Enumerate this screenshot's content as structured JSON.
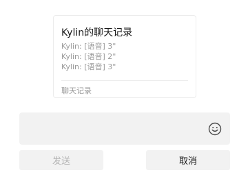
{
  "card": {
    "title": "Kylin的聊天记录",
    "messages": [
      "Kylin: [语音] 3\"",
      "Kylin: [语音] 2\"",
      "Kylin: [语音] 3\""
    ],
    "footer": "聊天记录"
  },
  "input": {
    "emoji_icon": "smiley-face-icon"
  },
  "buttons": {
    "send_label": "发送",
    "cancel_label": "取消"
  }
}
